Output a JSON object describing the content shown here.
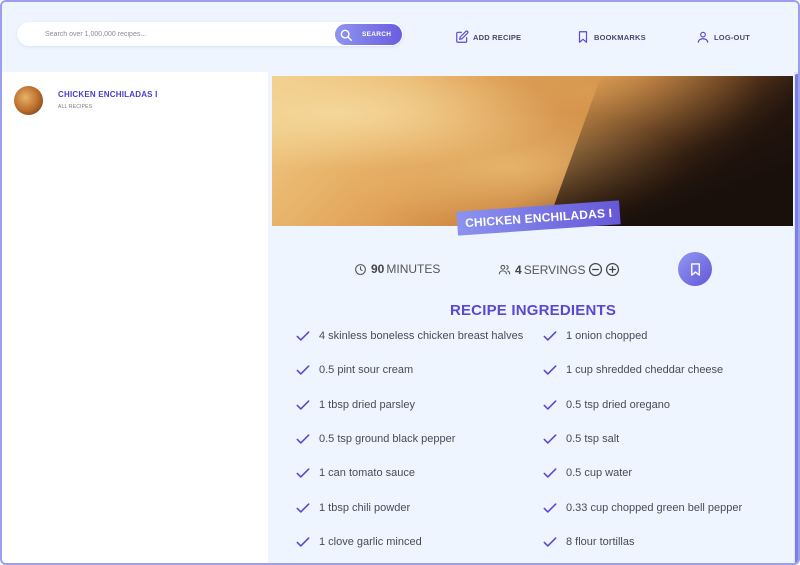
{
  "search": {
    "placeholder": "Search over 1,000,000 recipes...",
    "button_label": "SEARCH"
  },
  "nav": {
    "add_recipe": "ADD RECIPE",
    "bookmarks": "BOOKMARKS",
    "logout": "LOG-OUT"
  },
  "results": [
    {
      "title": "CHICKEN ENCHILADAS I",
      "publisher": "ALL RECIPES"
    }
  ],
  "recipe": {
    "title": "CHICKEN ENCHILADAS I",
    "cooking_time": "90",
    "cooking_time_unit": "MINUTES",
    "servings": "4",
    "servings_unit": "SERVINGS",
    "ingredients_heading": "RECIPE INGREDIENTS",
    "ingredients": [
      "4 skinless boneless chicken breast halves",
      "1 onion chopped",
      "0.5 pint sour cream",
      "1 cup shredded cheddar cheese",
      "1 tbsp dried parsley",
      "0.5 tsp dried oregano",
      "0.5 tsp ground black pepper",
      "0.5 tsp salt",
      "1 can tomato sauce",
      "0.5 cup water",
      "1 tbsp chili powder",
      "0.33 cup chopped green bell pepper",
      "1 clove garlic minced",
      "8 flour tortillas"
    ]
  },
  "colors": {
    "accent": "#5a48d0",
    "gradient_start": "#8f95ef",
    "gradient_end": "#6a5ddf",
    "frame": "#9c9ff0",
    "background": "#eef5ff"
  },
  "icons": {
    "search": "search-icon",
    "add_recipe": "edit-icon",
    "bookmarks": "bookmark-icon",
    "logout": "user-icon",
    "time": "clock-icon",
    "servings": "users-icon",
    "decrease": "minus-circle-icon",
    "increase": "plus-circle-icon",
    "check": "check-icon"
  }
}
